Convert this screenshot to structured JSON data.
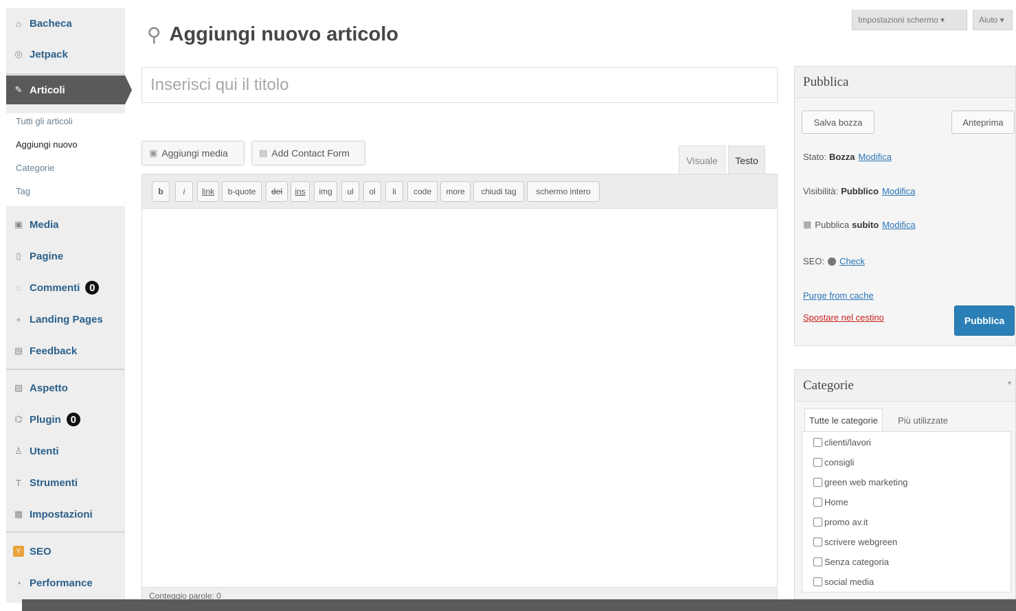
{
  "sidebar": {
    "items": [
      {
        "label": "Bacheca",
        "icon": "dashboard-icon",
        "glyph": "⌂"
      },
      {
        "label": "Jetpack",
        "icon": "jetpack-icon",
        "glyph": "◎"
      },
      {
        "label": "Articoli",
        "icon": "pin-icon",
        "glyph": "✎"
      },
      {
        "label": "Media",
        "icon": "media-icon",
        "glyph": "▣"
      },
      {
        "label": "Pagine",
        "icon": "page-icon",
        "glyph": "▯"
      },
      {
        "label": "Commenti",
        "icon": "comment-icon",
        "glyph": "◌",
        "badge": "0"
      },
      {
        "label": "Landing Pages",
        "icon": "plus-icon",
        "glyph": "+"
      },
      {
        "label": "Feedback",
        "icon": "feedback-icon",
        "glyph": "▤"
      },
      {
        "label": "Aspetto",
        "icon": "appearance-icon",
        "glyph": "▨"
      },
      {
        "label": "Plugin",
        "icon": "plugin-icon",
        "glyph": "⌬",
        "badge": "0"
      },
      {
        "label": "Utenti",
        "icon": "users-icon",
        "glyph": "♙"
      },
      {
        "label": "Strumenti",
        "icon": "tools-icon",
        "glyph": "T"
      },
      {
        "label": "Impostazioni",
        "icon": "settings-icon",
        "glyph": "▦"
      },
      {
        "label": "SEO",
        "icon": "seo-icon",
        "glyph": "Y"
      },
      {
        "label": "Performance",
        "icon": "performance-icon",
        "glyph": "◔"
      }
    ],
    "submenu": [
      "Tutti gli articoli",
      "Aggiungi nuovo",
      "Categorie",
      "Tag"
    ]
  },
  "header": {
    "title": "Aggiungi nuovo articolo",
    "screen_options": "Impostazioni schermo ▾",
    "help": "Aiuto ▾"
  },
  "editor": {
    "title_placeholder": "Inserisci qui il titolo",
    "add_media": "Aggiungi media",
    "add_contact_form": "Add Contact Form",
    "tab_visual": "Visuale",
    "tab_text": "Testo",
    "quicktags": [
      "b",
      "i",
      "link",
      "b-quote",
      "del",
      "ins",
      "img",
      "ul",
      "ol",
      "li",
      "code",
      "more",
      "chiudi tag",
      "schermo intero"
    ],
    "word_count": "Conteggio parole: 0"
  },
  "publish": {
    "title": "Pubblica",
    "save_draft": "Salva bozza",
    "preview": "Anteprima",
    "status_label": "Stato:",
    "status_value": "Bozza",
    "visibility_label": "Visibilità:",
    "visibility_value": "Pubblico",
    "schedule_label": "Pubblica",
    "schedule_value": "subito",
    "edit_link": "Modifica",
    "seo_label": "SEO:",
    "seo_link": "Check",
    "purge": "Purge from cache",
    "trash": "Spostare nel cestino",
    "publish_button": "Pubblica"
  },
  "categories": {
    "title": "Categorie",
    "tab_all": "Tutte le categorie",
    "tab_most_used": "Più utilizzate",
    "items": [
      "clienti/lavori",
      "consigli",
      "green web marketing",
      "Home",
      "promo av.it",
      "scrivere webgreen",
      "Senza categoria",
      "social media"
    ]
  },
  "colors": {
    "primary": "#2b7fb7",
    "sidebar_active": "#5a5a5a",
    "link": "#2a74b8",
    "danger": "#cc2222"
  }
}
